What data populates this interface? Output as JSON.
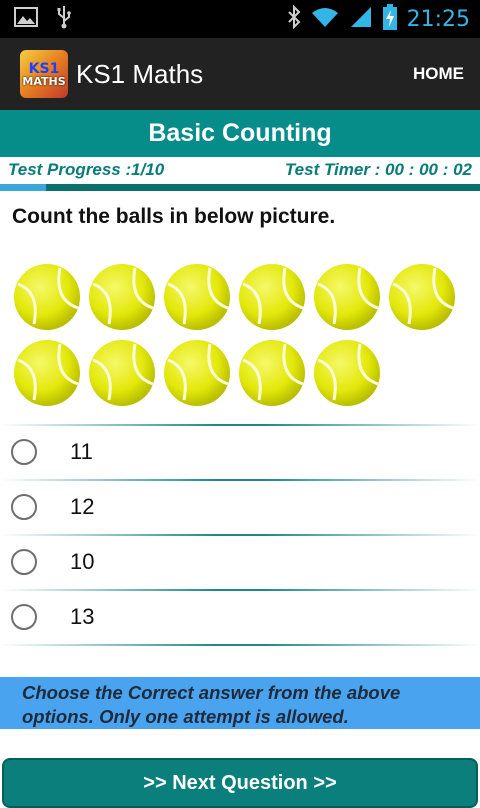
{
  "status_bar": {
    "time": "21:25",
    "icons": [
      "image-icon",
      "usb-icon",
      "bluetooth-icon",
      "wifi-icon",
      "signal-icon",
      "battery-charging-icon"
    ]
  },
  "action_bar": {
    "logo_text_top": "KS1",
    "logo_text_bottom": "MATHS",
    "app_title": "KS1 Maths",
    "home_label": "HOME"
  },
  "title": "Basic Counting",
  "progress": {
    "label": "Test Progress :1/10",
    "timer": "Test Timer : 00 : 00 : 02",
    "fraction": 0.1
  },
  "question": "Count the balls in below picture.",
  "ball_count": 11,
  "options": [
    {
      "label": "11"
    },
    {
      "label": "12"
    },
    {
      "label": "10"
    },
    {
      "label": "13"
    }
  ],
  "instructions": "Choose the Correct answer from the above options. Only one attempt is allowed.",
  "next_button": ">>   Next Question   >>",
  "colors": {
    "teal": "#068c89",
    "instruction_bg": "#4aa3ef",
    "progress_fill": "#3aa7dc",
    "ball": "#e3e80a"
  }
}
